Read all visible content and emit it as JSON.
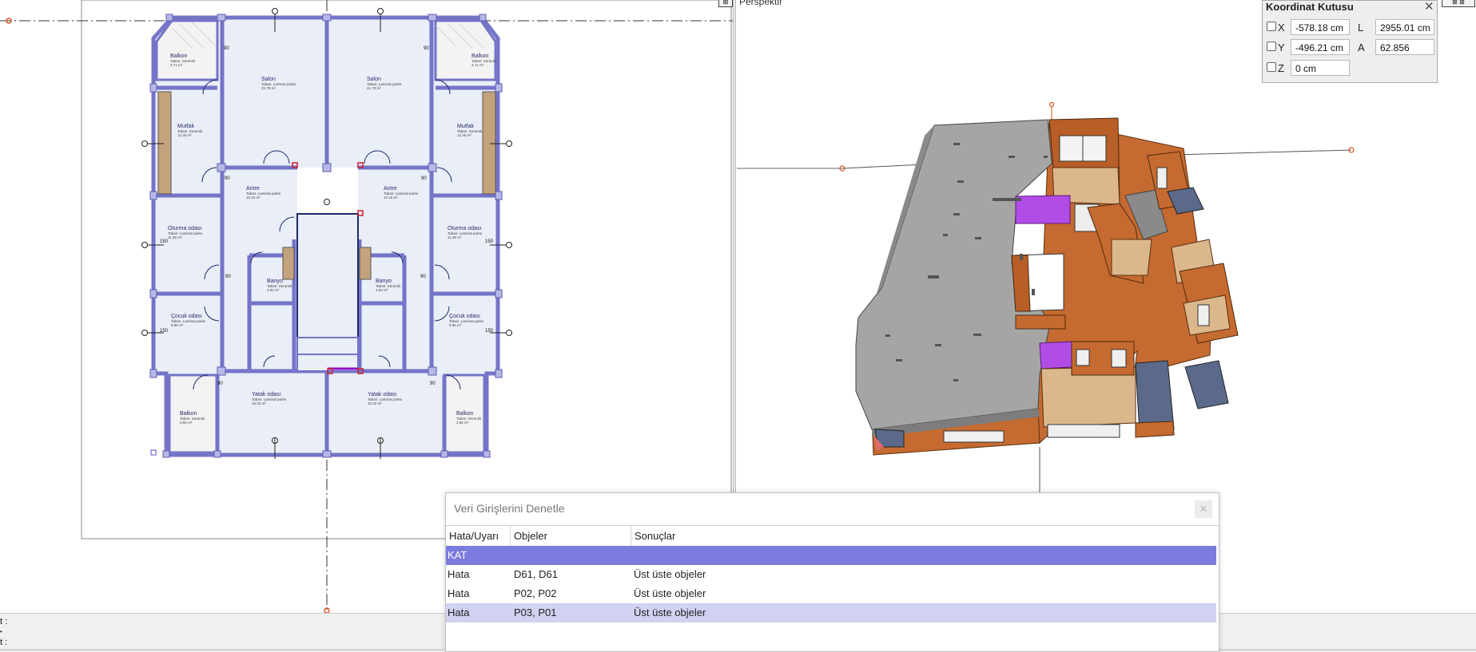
{
  "perspective_view": {
    "label": "Perspektif"
  },
  "coordinate_box": {
    "title": "Koordinat Kutusu",
    "close": "✕",
    "fields": {
      "x_label": "X",
      "x_value": "-578.18 cm",
      "y_label": "Y",
      "y_value": "-496.21 cm",
      "z_label": "Z",
      "z_value": "0 cm",
      "l_label": "L",
      "l_value": "2955.01 cm",
      "a_label": "A",
      "a_value": "62.856"
    }
  },
  "plan": {
    "rooms": [
      {
        "name": "Balkon",
        "finish": "Taban: Seramik",
        "area": "3.71 m²"
      },
      {
        "name": "Salon",
        "finish": "Taban: Laminat parke",
        "area": "21.78 m²"
      },
      {
        "name": "Salon",
        "finish": "Taban: Laminat parke",
        "area": "21.78 m²"
      },
      {
        "name": "Balkon",
        "finish": "Taban: Seramik",
        "area": "3.71 m²"
      },
      {
        "name": "Mutfak",
        "finish": "Taban: Seramik",
        "area": "12.26 m²"
      },
      {
        "name": "Mutfak",
        "finish": "Taban: Seramik",
        "area": "12.26 m²"
      },
      {
        "name": "Antre",
        "finish": "Taban: Laminat parke",
        "area": "10.16 m²"
      },
      {
        "name": "Antre",
        "finish": "Taban: Laminat parke",
        "area": "10.16 m²"
      },
      {
        "name": "Oturma odası",
        "finish": "Taban: Laminat parke",
        "area": "11.45 m²"
      },
      {
        "name": "Oturma odası",
        "finish": "Taban: Laminat parke",
        "area": "11.45 m²"
      },
      {
        "name": "Banyo",
        "finish": "Taban: Seramik",
        "area": "4.92 m²"
      },
      {
        "name": "Banyo",
        "finish": "Taban: Seramik",
        "area": "4.92 m²"
      },
      {
        "name": "Çocuk odası",
        "finish": "Taban: Laminat parke",
        "area": "9.86 m²"
      },
      {
        "name": "Çocuk odası",
        "finish": "Taban: Laminat parke",
        "area": "9.86 m²"
      },
      {
        "name": "Balkon",
        "finish": "Taban: Seramik",
        "area": "3.86 m²"
      },
      {
        "name": "Yatak odası",
        "finish": "Taban: Laminat parke",
        "area": "16.22 m²"
      },
      {
        "name": "Yatak odası",
        "finish": "Taban: Laminat parke",
        "area": "16.22 m²"
      },
      {
        "name": "Balkon",
        "finish": "Taban: Seramik",
        "area": "3.86 m²"
      }
    ],
    "dims": [
      "90",
      "150"
    ]
  },
  "status_bar": {
    "line1": "t :",
    "line2": "t :"
  },
  "dialog": {
    "title": "Veri Girişlerini Denetle",
    "close": "✕",
    "columns": [
      "Hata/Uyarı",
      "Objeler",
      "Sonuçlar"
    ],
    "group_label": "KAT",
    "rows": [
      {
        "type": "Hata",
        "objects": "D61, D61",
        "result": "Üst üste objeler"
      },
      {
        "type": "Hata",
        "objects": "P02, P02",
        "result": "Üst üste objeler"
      },
      {
        "type": "Hata",
        "objects": "P03, P01",
        "result": "Üst üste objeler"
      }
    ]
  },
  "colors": {
    "group_row": "#7b7be0",
    "selected_row": "#d1d1f1",
    "wall": "#7474c8",
    "room_fill": "#e9eef7",
    "balcony_fill": "#f2f2f2",
    "slab": "#a9a9a9",
    "brick": "#c96a2e",
    "floor_wood": "#ddb98b",
    "purple": "#b14de6"
  }
}
